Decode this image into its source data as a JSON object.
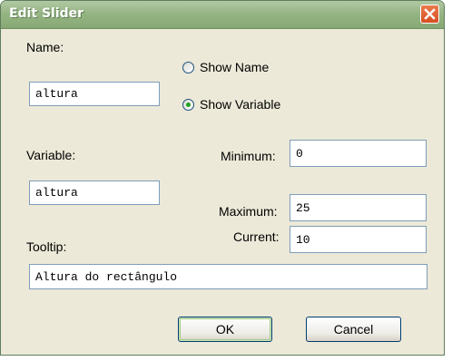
{
  "window": {
    "title": "Edit Slider",
    "close_icon": "close-x-icon"
  },
  "name": {
    "label": "Name:",
    "value": "altura"
  },
  "display_mode": {
    "options": [
      "Show Name",
      "Show Variable"
    ],
    "selected": "Show Variable"
  },
  "variable": {
    "label": "Variable:",
    "value": "altura"
  },
  "range": {
    "minimum_label": "Minimum:",
    "minimum_value": "0",
    "maximum_label": "Maximum:",
    "maximum_value": "25",
    "current_label": "Current:",
    "current_value": "10"
  },
  "tooltip": {
    "label": "Tooltip:",
    "value": "Altura do rectângulo"
  },
  "buttons": {
    "ok": "OK",
    "cancel": "Cancel"
  },
  "colors": {
    "titlebar": "#96b584",
    "close_button": "#d64e22",
    "client_bg": "#ece9d8",
    "radio_dot": "#21a121"
  }
}
